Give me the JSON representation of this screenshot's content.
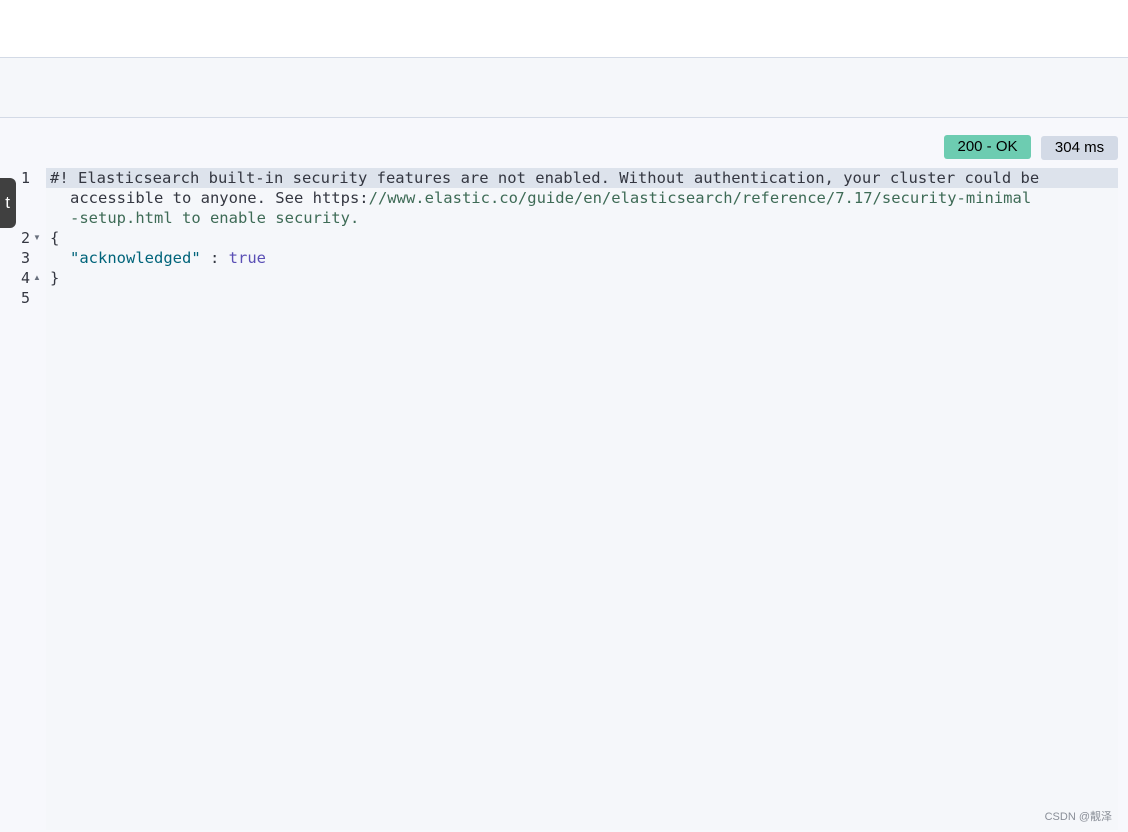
{
  "response": {
    "status": "200 - OK",
    "time": "304 ms"
  },
  "side_tab": {
    "label": "t"
  },
  "editor": {
    "line_numbers": [
      "1",
      "2",
      "3",
      "4",
      "5"
    ],
    "line1_a": "#! Elasticsearch built-in security features are not enabled. Without authentication, your cluster could be",
    "line1_b_plain": "accessible to anyone. See https:",
    "line1_b_link": "//www.elastic.co/guide/en/elasticsearch/reference/7.17/security-minimal",
    "line1_c_link": "-setup.html to enable security.",
    "line2": "{",
    "line3_key": "\"acknowledged\"",
    "line3_sep": " : ",
    "line3_value": "true",
    "line4": "}"
  },
  "watermark": "CSDN @靓泽",
  "colors": {
    "status_ok": "#6dccb1",
    "time_badge": "#d3dae6",
    "key": "#00647a",
    "bool": "#5a4fb5"
  }
}
